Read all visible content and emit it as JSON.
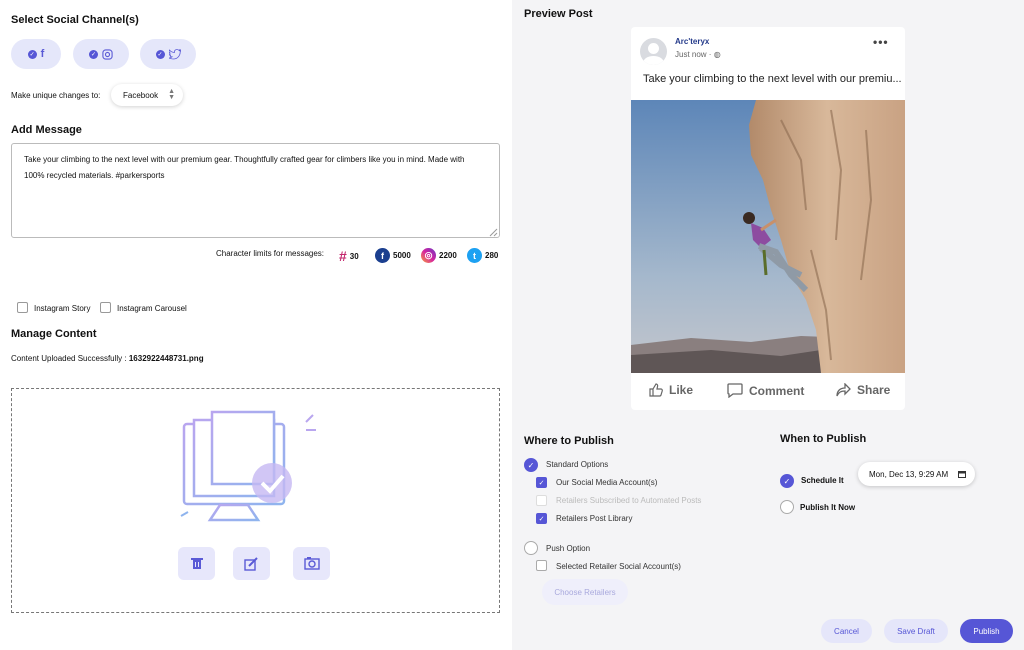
{
  "left": {
    "select_channels_title": "Select Social Channel(s)",
    "unique_changes_label": "Make unique changes to:",
    "unique_changes_value": "Facebook",
    "add_message_title": "Add Message",
    "message_text": "Take your climbing to the next level with our premium gear. Thoughtfully crafted gear for climbers like you in mind. Made with 100% recycled materials. #parkersports",
    "char_limits_label": "Character limits for messages:",
    "limits": {
      "hashtag": "30",
      "facebook": "5000",
      "instagram": "2200",
      "twitter": "280"
    },
    "instagram_story_label": "Instagram Story",
    "instagram_carousel_label": "Instagram Carousel",
    "manage_content_title": "Manage Content",
    "upload_status_label": "Content Uploaded Successfully :",
    "upload_filename": "1632922448731.png"
  },
  "preview": {
    "title": "Preview Post",
    "account_name": "Arc'teryx",
    "post_time": "Just now ·",
    "post_text": "Take your climbing to the next level with our premiu...",
    "more_icon": "•••",
    "like_label": "Like",
    "comment_label": "Comment",
    "share_label": "Share"
  },
  "where": {
    "title": "Where to Publish",
    "standard_options": "Standard Options",
    "our_accounts": "Our Social Media Account(s)",
    "retailers_auto": "Retailers Subscribed to Automated Posts",
    "retailers_library": "Retailers Post Library",
    "push_option": "Push Option",
    "selected_retailer_accounts": "Selected Retailer Social Account(s)",
    "choose_retailers": "Choose Retailers"
  },
  "when": {
    "title": "When to Publish",
    "schedule_it": "Schedule It",
    "schedule_value": "Mon, Dec 13, 9:29 AM",
    "publish_now": "Publish It Now"
  },
  "actions": {
    "cancel": "Cancel",
    "save_draft": "Save Draft",
    "publish": "Publish"
  },
  "colors": {
    "accent": "#5656d6",
    "facebook": "#1877f2",
    "twitter": "#1da1f2",
    "instagram": "#d6249f"
  }
}
